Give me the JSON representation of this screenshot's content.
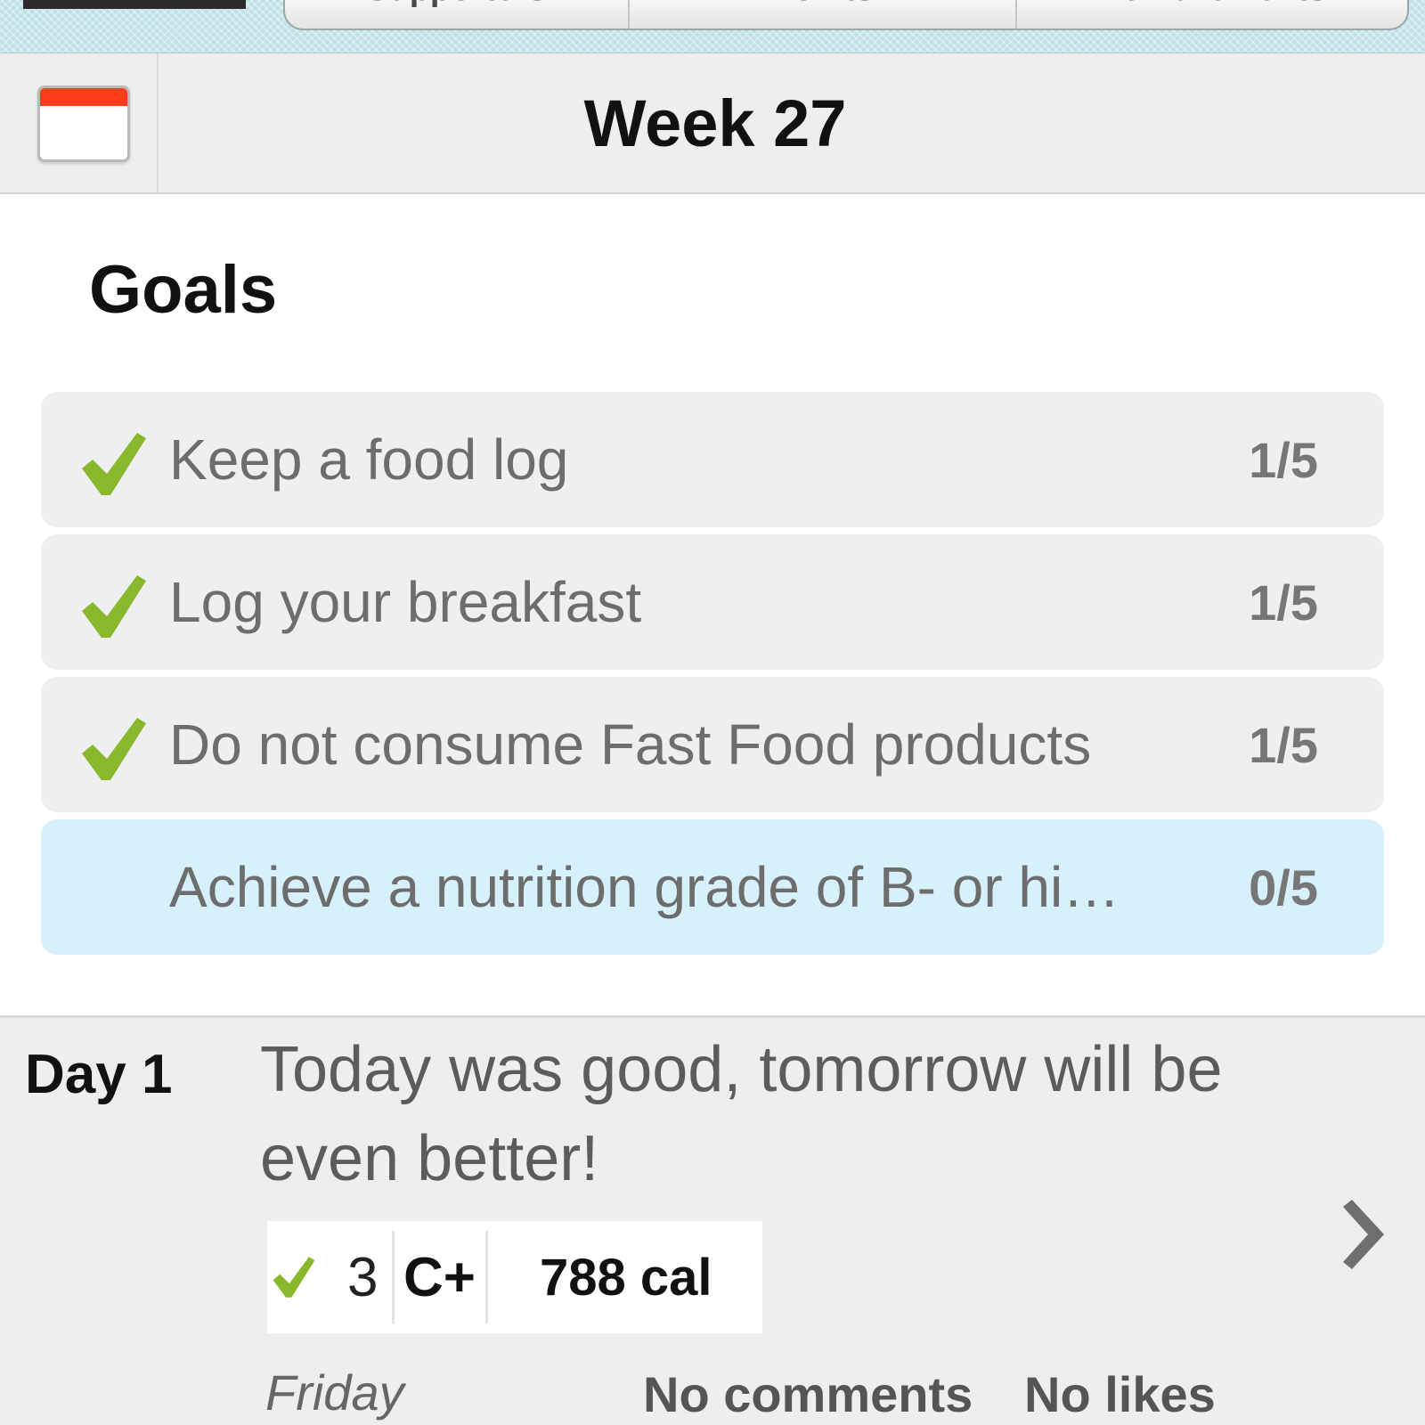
{
  "tabs": {
    "items": [
      {
        "label": "Supporters"
      },
      {
        "label": "Points"
      },
      {
        "label": "Achievements"
      }
    ]
  },
  "header": {
    "title": "Week 27",
    "calendar_icon": "calendar-icon"
  },
  "goals": {
    "title": "Goals",
    "accent_color": "#8ab82c",
    "highlight_color": "#d6f1fb",
    "items": [
      {
        "label": "Keep a food log",
        "count": "1/5",
        "checked": true
      },
      {
        "label": "Log your breakfast",
        "count": "1/5",
        "checked": true
      },
      {
        "label": "Do not consume Fast Food products",
        "count": "1/5",
        "checked": true
      },
      {
        "label": "Achieve a nutrition grade of B- or hi…",
        "count": "0/5",
        "checked": false
      }
    ]
  },
  "day": {
    "label": "Day 1",
    "note": "Today was good, tomorrow will be even better!",
    "goals_met": "3",
    "grade": "C+",
    "calories": "788 cal",
    "weekday": "Friday",
    "comments": "No comments",
    "likes": "No likes",
    "chevron_icon": "chevron-right-icon"
  }
}
